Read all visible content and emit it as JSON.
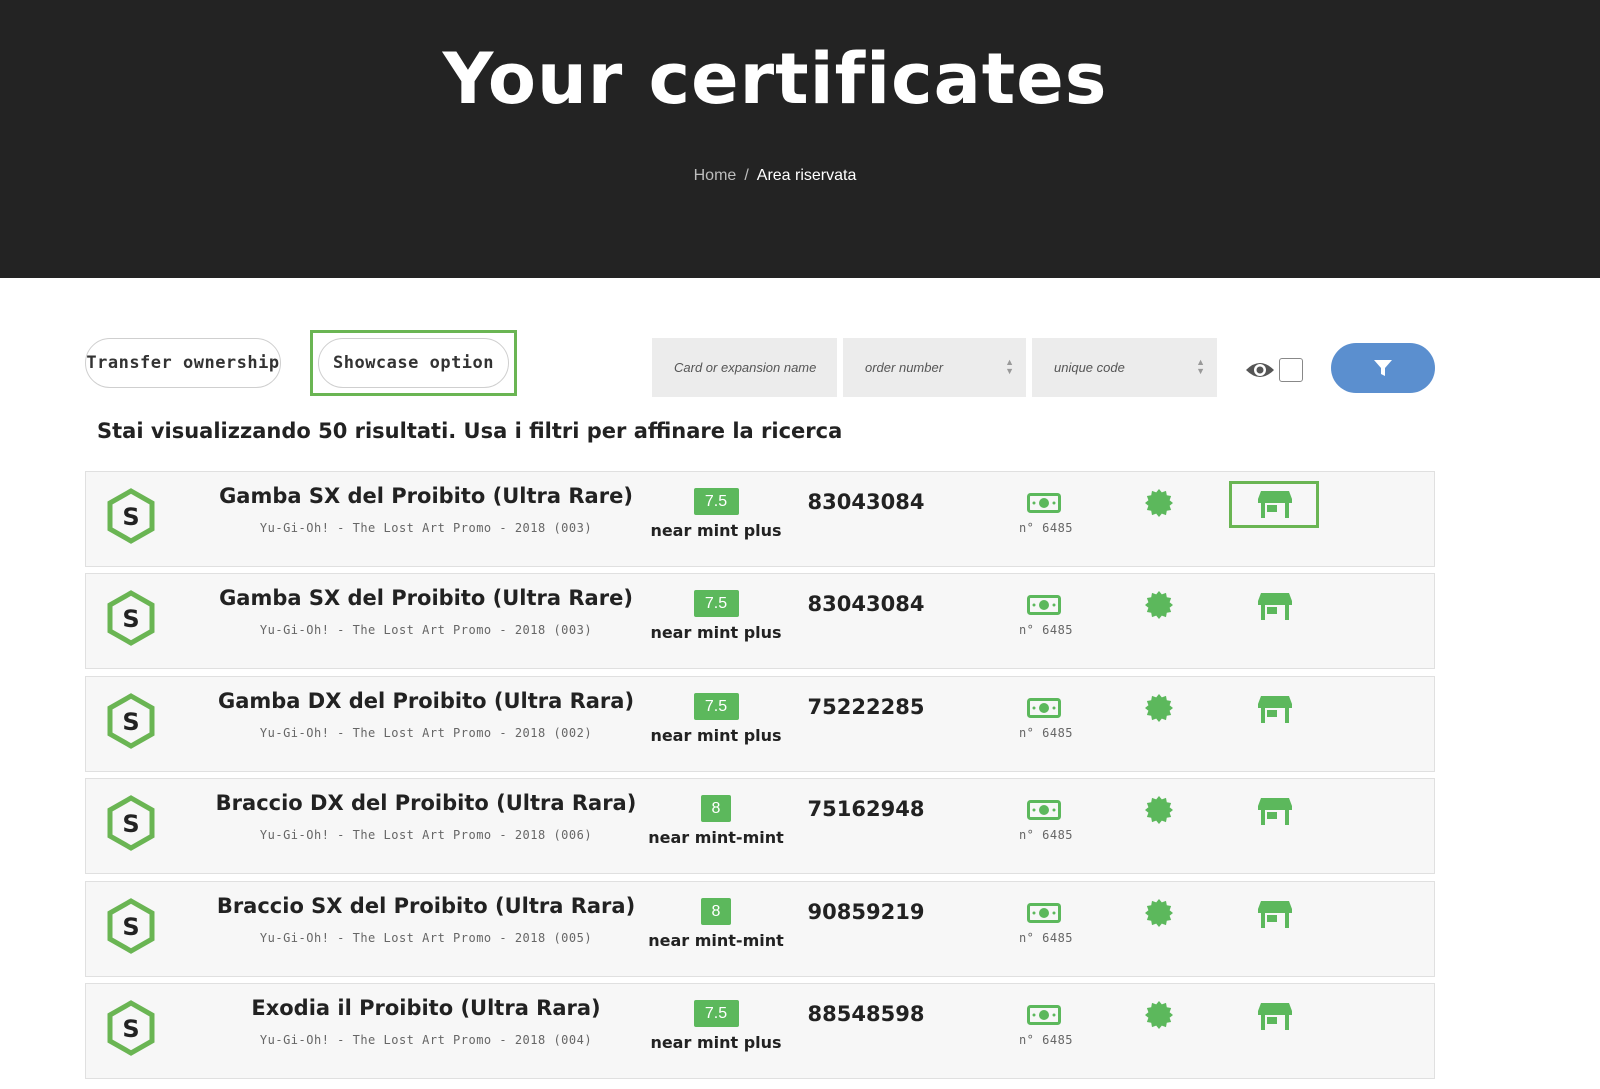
{
  "hero": {
    "title": "Your certificates",
    "breadcrumb": {
      "home": "Home",
      "separator": "/",
      "current": "Area riservata"
    }
  },
  "toolbar": {
    "transfer_label": "Transfer ownership",
    "showcase_label": "Showcase option",
    "search_placeholder": "Card or expansion name",
    "order_placeholder": "order number",
    "code_placeholder": "unique code"
  },
  "results_text": "Stai visualizzando 50 risultati. Usa i filtri per affinare la ricerca",
  "colors": {
    "accent_green": "#6ab553",
    "grade_green": "#5cb85c",
    "filter_blue": "#5b8fcf",
    "hero_bg": "#232323"
  },
  "icons": [
    "s-hexagon-icon",
    "money-icon",
    "seal-badge-icon",
    "shop-icon",
    "eye-icon",
    "filter-icon"
  ],
  "rows": [
    {
      "title": "Gamba SX del Proibito (Ultra Rare)",
      "subtitle": "Yu-Gi-Oh! - The Lost Art Promo - 2018 (003)",
      "grade": "7.5",
      "grade_label": "near mint plus",
      "code": "83043084",
      "order": "n° 6485"
    },
    {
      "title": "Gamba SX del Proibito (Ultra Rare)",
      "subtitle": "Yu-Gi-Oh! - The Lost Art Promo - 2018 (003)",
      "grade": "7.5",
      "grade_label": "near mint plus",
      "code": "83043084",
      "order": "n° 6485"
    },
    {
      "title": "Gamba DX del Proibito (Ultra Rara)",
      "subtitle": "Yu-Gi-Oh! - The Lost Art Promo - 2018 (002)",
      "grade": "7.5",
      "grade_label": "near mint plus",
      "code": "75222285",
      "order": "n° 6485"
    },
    {
      "title": "Braccio DX del Proibito (Ultra Rara)",
      "subtitle": "Yu-Gi-Oh! - The Lost Art Promo - 2018 (006)",
      "grade": "8",
      "grade_label": "near mint-mint",
      "code": "75162948",
      "order": "n° 6485"
    },
    {
      "title": "Braccio SX del Proibito (Ultra Rara)",
      "subtitle": "Yu-Gi-Oh! - The Lost Art Promo - 2018 (005)",
      "grade": "8",
      "grade_label": "near mint-mint",
      "code": "90859219",
      "order": "n° 6485"
    },
    {
      "title": "Exodia il Proibito (Ultra Rara)",
      "subtitle": "Yu-Gi-Oh! - The Lost Art Promo - 2018 (004)",
      "grade": "7.5",
      "grade_label": "near mint plus",
      "code": "88548598",
      "order": "n° 6485"
    }
  ]
}
